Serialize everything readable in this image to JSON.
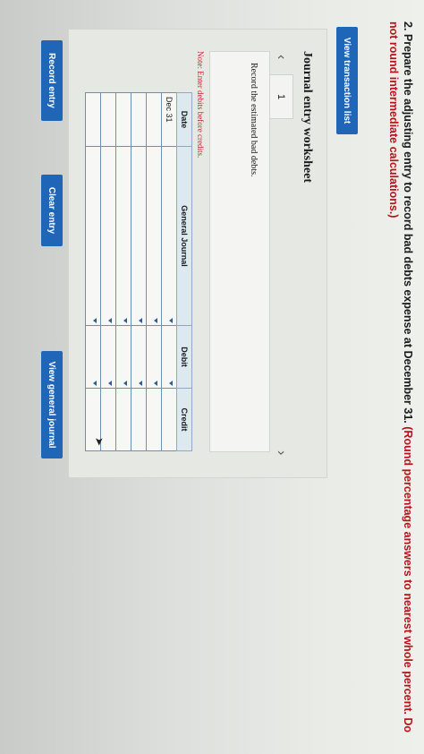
{
  "question": {
    "prefix": "2. Prepare the adjusting entry to record bad debts expense at December 31.",
    "emphasis": "(Round percentage answers to nearest whole percent. Do not round intermediate calculations.)"
  },
  "buttons": {
    "view_transaction_list": "View transaction list",
    "record_entry": "Record entry",
    "clear_entry": "Clear entry",
    "view_general_journal": "View general journal"
  },
  "worksheet": {
    "title": "Journal entry worksheet",
    "tab_number": "1",
    "instruction": "Record the estimated bad debts.",
    "note": "Note: Enter debits before credits.",
    "headers": {
      "date": "Date",
      "general_journal": "General Journal",
      "debit": "Debit",
      "credit": "Credit"
    },
    "rows": [
      {
        "date": "Dec 31"
      },
      {
        "date": ""
      },
      {
        "date": ""
      },
      {
        "date": ""
      },
      {
        "date": ""
      },
      {
        "date": ""
      }
    ]
  },
  "colors": {
    "button_blue": "#1f66b8",
    "emphasis_red": "#b4141a"
  }
}
